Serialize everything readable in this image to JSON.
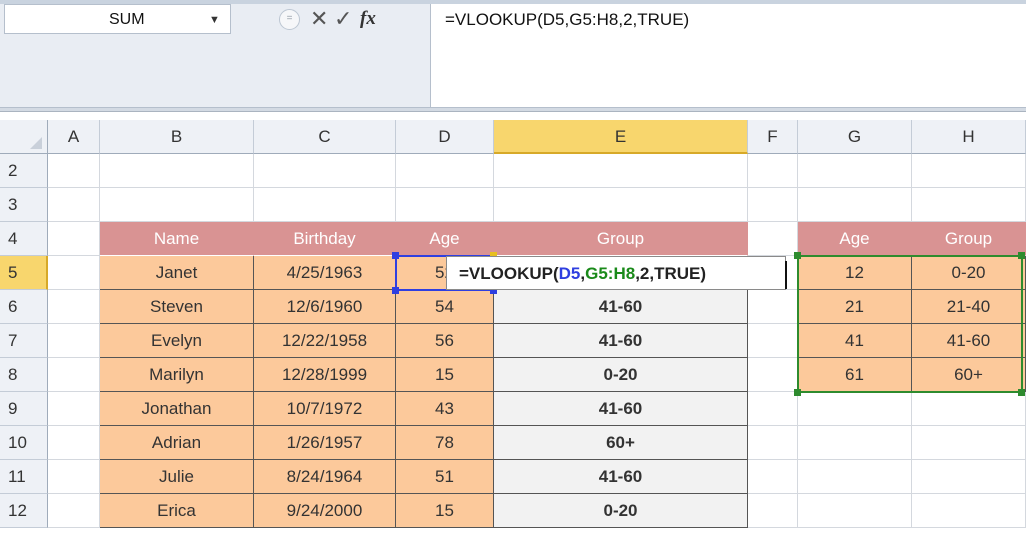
{
  "formula_bar": {
    "name_box": "SUM",
    "fx_label": "fx",
    "formula": "=VLOOKUP(D5,G5:H8,2,TRUE)"
  },
  "columns": [
    "A",
    "B",
    "C",
    "D",
    "E",
    "F",
    "G",
    "H"
  ],
  "rows": [
    "2",
    "3",
    "4",
    "5",
    "6",
    "7",
    "8",
    "9",
    "10",
    "11",
    "12"
  ],
  "table": {
    "headers": [
      "Name",
      "Birthday",
      "Age",
      "Group"
    ],
    "rows": [
      [
        "Janet",
        "4/25/1963",
        "52",
        ""
      ],
      [
        "Steven",
        "12/6/1960",
        "54",
        "41-60"
      ],
      [
        "Evelyn",
        "12/22/1958",
        "56",
        "41-60"
      ],
      [
        "Marilyn",
        "12/28/1999",
        "15",
        "0-20"
      ],
      [
        "Jonathan",
        "10/7/1972",
        "43",
        "41-60"
      ],
      [
        "Adrian",
        "1/26/1957",
        "78",
        "60+"
      ],
      [
        "Julie",
        "8/24/1964",
        "51",
        "41-60"
      ],
      [
        "Erica",
        "9/24/2000",
        "15",
        "0-20"
      ]
    ]
  },
  "lookup": {
    "headers": [
      "Age",
      "Group"
    ],
    "rows": [
      [
        "12",
        "0-20"
      ],
      [
        "21",
        "21-40"
      ],
      [
        "41",
        "41-60"
      ],
      [
        "61",
        "60+"
      ]
    ]
  },
  "editor": {
    "prefix": "=VLOOKUP(",
    "ref1": "D5",
    "sep1": ",",
    "ref2": "G5:H8",
    "suffix": ",2,TRUE)"
  },
  "active_cell": "E5",
  "colors": {
    "header_fill": "#d99393",
    "data_fill": "#fcc99b",
    "result_fill": "#f2f2f2",
    "ref1_color": "#2f3fe0",
    "ref2_color": "#1a8a1a",
    "active_header": "#f8d66d"
  },
  "icons": [
    "dropdown-arrow-icon",
    "cancel-x-icon",
    "enter-check-icon",
    "insert-function-icon"
  ]
}
